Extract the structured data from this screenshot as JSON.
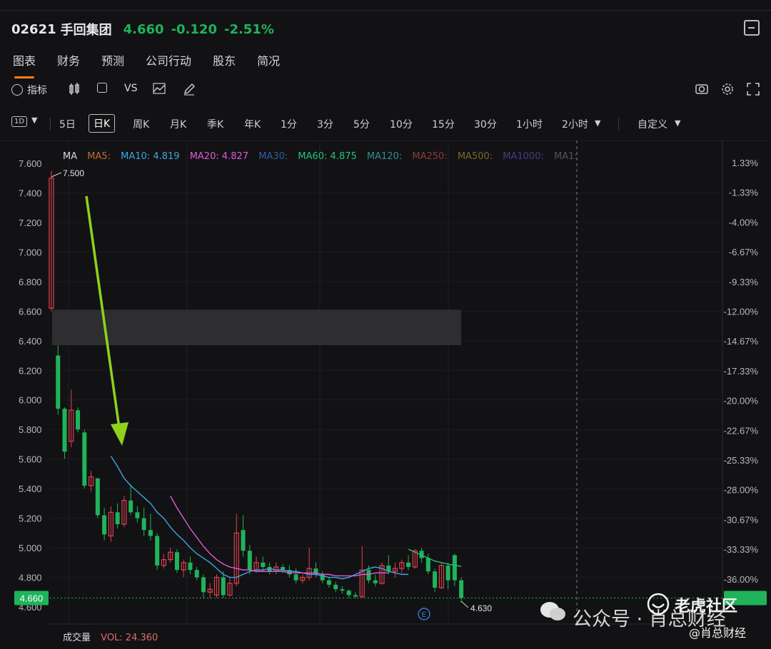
{
  "header": {
    "code": "02621",
    "name": "手回集团",
    "price": "4.660",
    "change": "-0.120",
    "change_pct": "-2.51%"
  },
  "tabs": [
    "图表",
    "财务",
    "预测",
    "公司行动",
    "股东",
    "简况"
  ],
  "toolbar": {
    "indicator_label": "指标",
    "vs_label": "VS"
  },
  "periods": {
    "first": "1D",
    "items": [
      "5日",
      "日K",
      "周K",
      "月K",
      "季K",
      "年K",
      "1分",
      "3分",
      "5分",
      "10分",
      "15分",
      "30分",
      "1小时",
      "2小时"
    ],
    "selected": "日K",
    "custom": "自定义"
  },
  "ma_legend": {
    "label": "MA",
    "items": [
      {
        "text": "MA5:",
        "color": "#c46a33"
      },
      {
        "text": "MA10: 4.819",
        "color": "#3fa4e6"
      },
      {
        "text": "MA20: 4.827",
        "color": "#e05ad6"
      },
      {
        "text": "MA30:",
        "color": "#2f5ea8"
      },
      {
        "text": "MA60: 4.875",
        "color": "#27c27a"
      },
      {
        "text": "MA120:",
        "color": "#2f8f8f"
      },
      {
        "text": "MA250:",
        "color": "#8a3a3a"
      },
      {
        "text": "MA500:",
        "color": "#7a6a2a"
      },
      {
        "text": "MA1000:",
        "color": "#4a3a8a"
      },
      {
        "text": "MA1:",
        "color": "#555559"
      }
    ]
  },
  "price_axis": [
    "7.600",
    "7.400",
    "7.200",
    "7.000",
    "6.800",
    "6.600",
    "6.400",
    "6.200",
    "6.000",
    "5.800",
    "5.600",
    "5.400",
    "5.200",
    "5.000",
    "4.800",
    "4.600"
  ],
  "pct_axis": [
    "1.33%",
    "-1.33%",
    "-4.00%",
    "-6.67%",
    "-9.33%",
    "-12.00%",
    "-14.67%",
    "-17.33%",
    "-20.00%",
    "-22.67%",
    "-25.33%",
    "-28.00%",
    "-30.67%",
    "-33.33%",
    "-36.00%"
  ],
  "current_price_tag": "4.660",
  "high_label": "7.500",
  "low_label": "4.630",
  "earnings_marker": "E",
  "volume": {
    "label": "成交量",
    "value": "VOL: 24.360"
  },
  "colors": {
    "up": "#e0414f",
    "down": "#20b35a",
    "ma10": "#3fa4e6",
    "ma20": "#e05ad6",
    "ma60": "#27c27a",
    "arrow": "#8ed21e",
    "accent": "#ff7a1a"
  },
  "watermark": {
    "text": "公众号 · 肖总财经",
    "brand": "老虎社区",
    "handle": "@肖总财经"
  },
  "chart_data": {
    "type": "candlestick",
    "ylim": [
      4.6,
      7.6
    ],
    "candles": [
      {
        "o": 6.62,
        "h": 7.55,
        "l": 6.6,
        "c": 7.5
      },
      {
        "o": 6.3,
        "h": 6.37,
        "l": 5.9,
        "c": 5.94
      },
      {
        "o": 5.94,
        "h": 5.95,
        "l": 5.6,
        "c": 5.65
      },
      {
        "o": 5.72,
        "h": 6.07,
        "l": 5.68,
        "c": 5.93
      },
      {
        "o": 5.93,
        "h": 5.95,
        "l": 5.78,
        "c": 5.8
      },
      {
        "o": 5.78,
        "h": 5.8,
        "l": 5.4,
        "c": 5.42
      },
      {
        "o": 5.42,
        "h": 5.52,
        "l": 5.38,
        "c": 5.48
      },
      {
        "o": 5.47,
        "h": 5.47,
        "l": 5.2,
        "c": 5.22
      },
      {
        "o": 5.22,
        "h": 5.27,
        "l": 5.05,
        "c": 5.09
      },
      {
        "o": 5.08,
        "h": 5.28,
        "l": 5.04,
        "c": 5.24
      },
      {
        "o": 5.24,
        "h": 5.3,
        "l": 5.13,
        "c": 5.16
      },
      {
        "o": 5.16,
        "h": 5.35,
        "l": 5.14,
        "c": 5.32
      },
      {
        "o": 5.32,
        "h": 5.43,
        "l": 5.22,
        "c": 5.24
      },
      {
        "o": 5.24,
        "h": 5.28,
        "l": 5.17,
        "c": 5.2
      },
      {
        "o": 5.2,
        "h": 5.27,
        "l": 5.08,
        "c": 5.12
      },
      {
        "o": 5.12,
        "h": 5.23,
        "l": 5.05,
        "c": 5.08
      },
      {
        "o": 5.08,
        "h": 5.1,
        "l": 4.85,
        "c": 4.88
      },
      {
        "o": 4.88,
        "h": 4.96,
        "l": 4.86,
        "c": 4.92
      },
      {
        "o": 4.92,
        "h": 5.0,
        "l": 4.9,
        "c": 4.97
      },
      {
        "o": 4.97,
        "h": 4.99,
        "l": 4.83,
        "c": 4.85
      },
      {
        "o": 4.85,
        "h": 4.92,
        "l": 4.8,
        "c": 4.9
      },
      {
        "o": 4.9,
        "h": 4.94,
        "l": 4.82,
        "c": 4.85
      },
      {
        "o": 4.85,
        "h": 4.87,
        "l": 4.78,
        "c": 4.8
      },
      {
        "o": 4.8,
        "h": 4.82,
        "l": 4.66,
        "c": 4.7
      },
      {
        "o": 4.7,
        "h": 4.76,
        "l": 4.66,
        "c": 4.72
      },
      {
        "o": 4.68,
        "h": 4.82,
        "l": 4.66,
        "c": 4.8
      },
      {
        "o": 4.8,
        "h": 4.84,
        "l": 4.66,
        "c": 4.68
      },
      {
        "o": 4.68,
        "h": 4.8,
        "l": 4.67,
        "c": 4.76
      },
      {
        "o": 4.76,
        "h": 5.23,
        "l": 4.74,
        "c": 5.1
      },
      {
        "o": 5.12,
        "h": 5.22,
        "l": 4.94,
        "c": 4.98
      },
      {
        "o": 4.98,
        "h": 5.02,
        "l": 4.82,
        "c": 4.85
      },
      {
        "o": 4.85,
        "h": 4.94,
        "l": 4.83,
        "c": 4.9
      },
      {
        "o": 4.9,
        "h": 4.94,
        "l": 4.84,
        "c": 4.87
      },
      {
        "o": 4.87,
        "h": 4.9,
        "l": 4.82,
        "c": 4.84
      },
      {
        "o": 4.84,
        "h": 4.9,
        "l": 4.82,
        "c": 4.87
      },
      {
        "o": 4.87,
        "h": 4.89,
        "l": 4.83,
        "c": 4.85
      },
      {
        "o": 4.85,
        "h": 4.88,
        "l": 4.8,
        "c": 4.82
      },
      {
        "o": 4.82,
        "h": 4.86,
        "l": 4.76,
        "c": 4.78
      },
      {
        "o": 4.78,
        "h": 4.82,
        "l": 4.76,
        "c": 4.8
      },
      {
        "o": 4.8,
        "h": 5.0,
        "l": 4.78,
        "c": 4.86
      },
      {
        "o": 4.86,
        "h": 4.9,
        "l": 4.8,
        "c": 4.82
      },
      {
        "o": 4.82,
        "h": 4.84,
        "l": 4.76,
        "c": 4.78
      },
      {
        "o": 4.78,
        "h": 4.8,
        "l": 4.73,
        "c": 4.75
      },
      {
        "o": 4.75,
        "h": 4.77,
        "l": 4.7,
        "c": 4.72
      },
      {
        "o": 4.72,
        "h": 4.74,
        "l": 4.69,
        "c": 4.71
      },
      {
        "o": 4.71,
        "h": 4.72,
        "l": 4.66,
        "c": 4.68
      },
      {
        "o": 4.68,
        "h": 4.7,
        "l": 4.66,
        "c": 4.67
      },
      {
        "o": 4.67,
        "h": 5.01,
        "l": 4.66,
        "c": 4.85
      },
      {
        "o": 4.85,
        "h": 4.88,
        "l": 4.76,
        "c": 4.78
      },
      {
        "o": 4.78,
        "h": 4.82,
        "l": 4.74,
        "c": 4.76
      },
      {
        "o": 4.76,
        "h": 4.9,
        "l": 4.75,
        "c": 4.88
      },
      {
        "o": 4.88,
        "h": 4.95,
        "l": 4.82,
        "c": 4.84
      },
      {
        "o": 4.84,
        "h": 4.9,
        "l": 4.8,
        "c": 4.86
      },
      {
        "o": 4.86,
        "h": 4.92,
        "l": 4.83,
        "c": 4.9
      },
      {
        "o": 4.9,
        "h": 4.95,
        "l": 4.85,
        "c": 4.87
      },
      {
        "o": 4.87,
        "h": 4.99,
        "l": 4.86,
        "c": 4.98
      },
      {
        "o": 4.98,
        "h": 5.0,
        "l": 4.9,
        "c": 4.93
      },
      {
        "o": 4.93,
        "h": 4.96,
        "l": 4.82,
        "c": 4.84
      },
      {
        "o": 4.84,
        "h": 4.86,
        "l": 4.7,
        "c": 4.73
      },
      {
        "o": 4.73,
        "h": 4.9,
        "l": 4.72,
        "c": 4.88
      },
      {
        "o": 4.88,
        "h": 4.9,
        "l": 4.72,
        "c": 4.78
      },
      {
        "o": 4.95,
        "h": 4.96,
        "l": 4.74,
        "c": 4.78
      },
      {
        "o": 4.78,
        "h": 4.8,
        "l": 4.63,
        "c": 4.66
      }
    ],
    "ma10_values": [
      5.62,
      5.55,
      5.47,
      5.42,
      5.38,
      5.34,
      5.3,
      5.24,
      5.2,
      5.14,
      5.09,
      5.05,
      5.0,
      4.96,
      4.93,
      4.9,
      4.86,
      4.82,
      4.8,
      4.8,
      4.82,
      4.84,
      4.85,
      4.85,
      4.86,
      4.85,
      4.85,
      4.84,
      4.84,
      4.83,
      4.82,
      4.82,
      4.81,
      4.8,
      4.8,
      4.79,
      4.8,
      4.82,
      4.84,
      4.86,
      4.87,
      4.86,
      4.84,
      4.83,
      4.82,
      4.82
    ],
    "ma20_values": [
      5.35,
      5.27,
      5.2,
      5.13,
      5.07,
      5.01,
      4.96,
      4.92,
      4.89,
      4.87,
      4.86,
      4.85,
      4.85,
      4.84,
      4.84,
      4.84,
      4.84,
      4.84,
      4.83,
      4.83,
      4.83,
      4.83,
      4.83,
      4.82,
      4.82,
      4.81,
      4.81,
      4.81,
      4.81,
      4.82,
      4.82,
      4.83,
      4.83,
      4.83
    ],
    "ma60_values": [
      4.99,
      4.97,
      4.95,
      4.93,
      4.91,
      4.9,
      4.89,
      4.88,
      4.875
    ]
  }
}
